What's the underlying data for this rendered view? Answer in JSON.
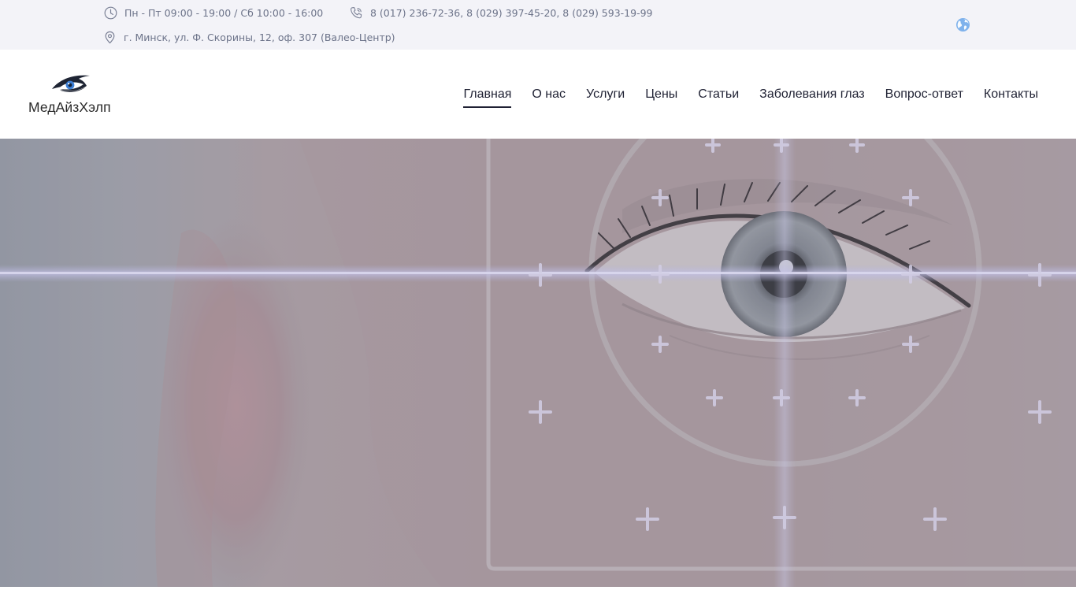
{
  "topbar": {
    "hours": "Пн - Пт 09:00 - 19:00 /  Сб 10:00 - 16:00",
    "phones": "8 (017) 236-72-36, 8 (029) 397-45-20,  8 (029) 593-19-99",
    "address": "г. Минск, ул. Ф. Скорины, 12,  оф. 307 (Валео-Центр)",
    "icons": {
      "hours": "clock-icon",
      "phones": "phone-icon",
      "address": "map-pin-icon",
      "language": "globe-icon"
    }
  },
  "header": {
    "logo_text": "МедАйзХэлп",
    "logo_icon": "eye-logo-icon"
  },
  "nav": {
    "items": [
      {
        "label": "Главная",
        "active": true
      },
      {
        "label": "О нас"
      },
      {
        "label": "Услуги"
      },
      {
        "label": "Цены"
      },
      {
        "label": "Статьи"
      },
      {
        "label": "Заболевания глаз"
      },
      {
        "label": "Вопрос-ответ"
      },
      {
        "label": "Контакты"
      }
    ]
  },
  "colors": {
    "topbar_bg": "#f3f3f8",
    "topbar_text": "#6c7389",
    "nav_text": "#1f2133",
    "accent_blue": "#3b7fd6"
  }
}
